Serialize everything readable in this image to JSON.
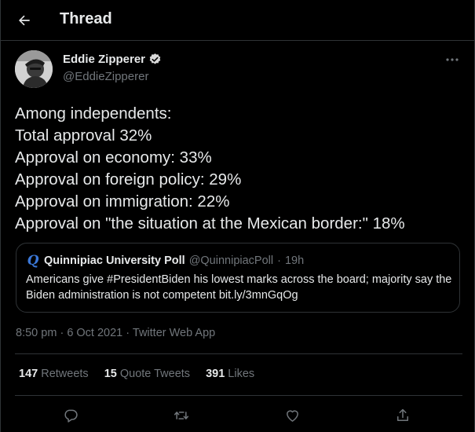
{
  "header": {
    "title": "Thread",
    "back_icon": "arrow-left-icon"
  },
  "author": {
    "name": "Eddie Zipperer",
    "handle": "@EddieZipperer",
    "verified_icon": "verified-badge-icon",
    "more_icon": "more-horizontal-icon"
  },
  "tweet": {
    "lines": [
      "Among independents:",
      "Total approval 32%",
      "Approval on economy: 33%",
      "Approval on foreign policy: 29%",
      "Approval on immigration: 22%",
      "Approval on \"the situation at the Mexican border:\" 18%"
    ]
  },
  "quote": {
    "logo_glyph": "Q",
    "name": "Quinnipiac University Poll",
    "handle": "@QuinnipiacPoll",
    "separator": "·",
    "time": "19h",
    "text": "Americans give #PresidentBiden his lowest marks across the board; majority say the Biden administration is not competent bit.ly/3mnGqOg"
  },
  "meta": {
    "time": "8:50 pm",
    "dot1": "·",
    "date": "6 Oct 2021",
    "dot2": "·",
    "source": "Twitter Web App"
  },
  "stats": {
    "retweets_count": "147",
    "retweets_label": "Retweets",
    "quotes_count": "15",
    "quotes_label": "Quote Tweets",
    "likes_count": "391",
    "likes_label": "Likes"
  },
  "colors": {
    "background": "#000000",
    "text": "#e7e9ea",
    "secondary": "#71767b",
    "border": "#2f3336",
    "verified": "#d9d9d9"
  }
}
